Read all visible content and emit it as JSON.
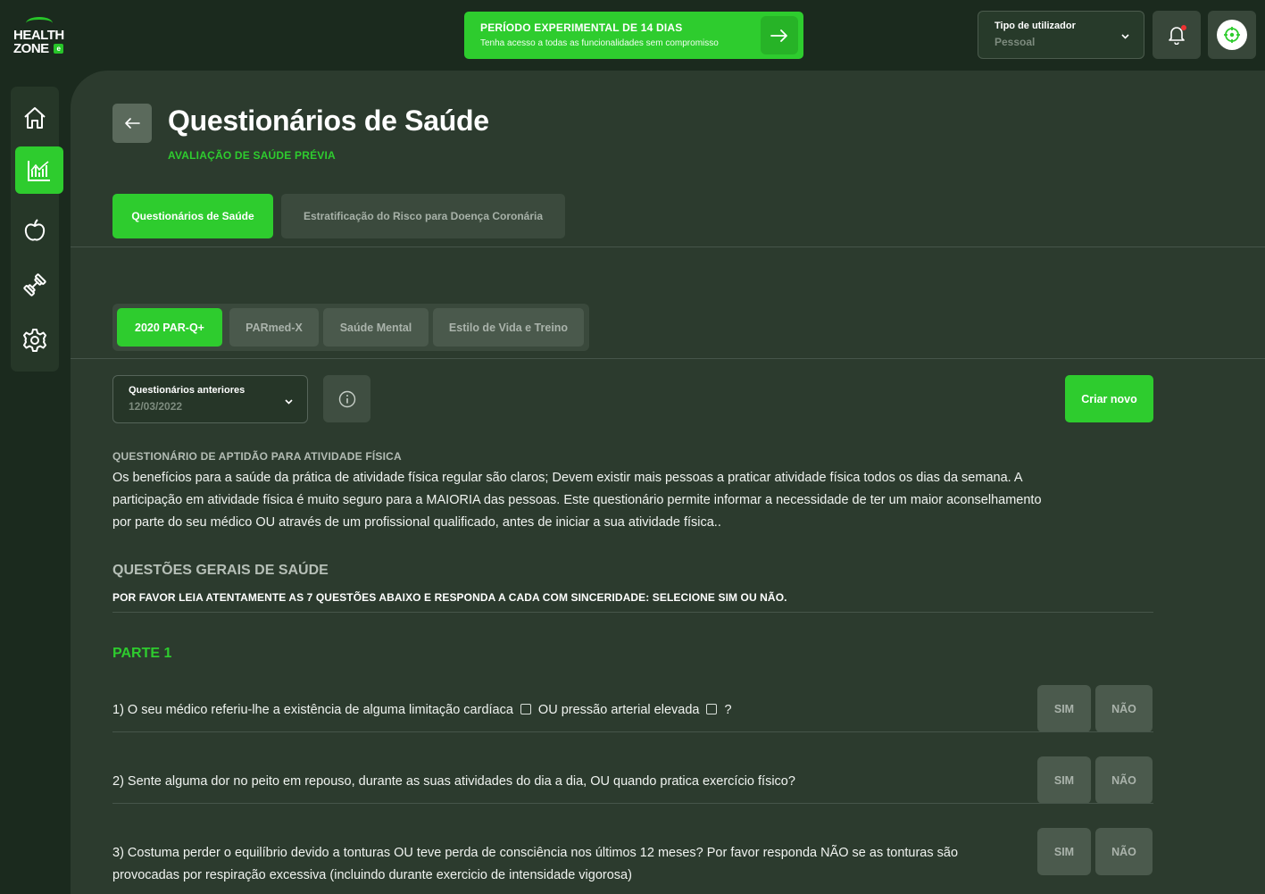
{
  "brand": {
    "line1": "HEALTH",
    "line2": "ZONE",
    "badge": "e"
  },
  "trial": {
    "title": "PERÍODO EXPERIMENTAL DE 14 DIAS",
    "subtitle": "Tenha acesso a todas as funcionalidades sem compromisso"
  },
  "user_type": {
    "label": "Tipo de utilizador",
    "value": "Pessoal"
  },
  "sidebar": {
    "items": [
      {
        "icon": "home-icon",
        "active": false
      },
      {
        "icon": "chart-icon",
        "active": true
      },
      {
        "icon": "apple-icon",
        "active": false
      },
      {
        "icon": "dumbbell-icon",
        "active": false
      },
      {
        "icon": "gear-icon",
        "active": false
      }
    ]
  },
  "page": {
    "title": "Questionários de Saúde",
    "subtitle": "AVALIAÇÃO DE SAÚDE PRÉVIA"
  },
  "top_tabs": [
    {
      "label": "Questionários de Saúde",
      "active": true
    },
    {
      "label": "Estratificação do Risco para Doença Coronária",
      "active": false
    }
  ],
  "sub_tabs": [
    {
      "label": "2020 PAR-Q+",
      "active": true
    },
    {
      "label": "PARmed-X",
      "active": false
    },
    {
      "label": "Saúde Mental",
      "active": false
    },
    {
      "label": "Estilo de Vida e Treino",
      "active": false
    }
  ],
  "previous": {
    "label": "Questionários anteriores",
    "value": "12/03/2022"
  },
  "create_label": "Criar novo",
  "intro": {
    "heading": "QUESTIONÁRIO DE APTIDÃO PARA ATIVIDADE FÍSICA",
    "text": "Os benefícios para a saúde da prática de atividade física regular são claros; Devem existir mais pessoas a praticar atividade física todos os dias da semana. A participação em atividade física é muito seguro para a MAIORIA das pessoas. Este questionário permite informar a necessidade de ter um maior aconselhamento por parte do seu médico OU através de um profissional qualificado, antes de iniciar a sua atividade física.."
  },
  "general": {
    "heading": "QUESTÕES GERAIS DE SAÚDE",
    "instruction": "POR FAVOR LEIA ATENTAMENTE AS 7 QUESTÕES ABAIXO E RESPONDA A CADA COM SINCERIDADE: SELECIONE SIM OU NÃO."
  },
  "part_label": "PARTE 1",
  "answers": {
    "yes": "SIM",
    "no": "NÃO"
  },
  "questions": {
    "q1": {
      "a": "1) O seu médico referiu-lhe a existência de alguma limitação cardíaca",
      "b": "OU pressão arterial elevada",
      "c": "?"
    },
    "q2": "2) Sente alguma dor no peito em repouso, durante as suas atividades do dia a dia, OU quando pratica exercício físico?",
    "q3": "3) Costuma perder o equilíbrio devido a tonturas OU teve perda de consciência nos últimos 12 meses? Por favor responda NÃO se as tonturas são provocadas por respiração excessiva (incluindo durante exercicio de intensidade vigorosa)"
  },
  "colors": {
    "accent": "#2ecc2e",
    "background": "#1b2a1e",
    "panel": "#2c3b2e",
    "notification": "#f03232"
  }
}
